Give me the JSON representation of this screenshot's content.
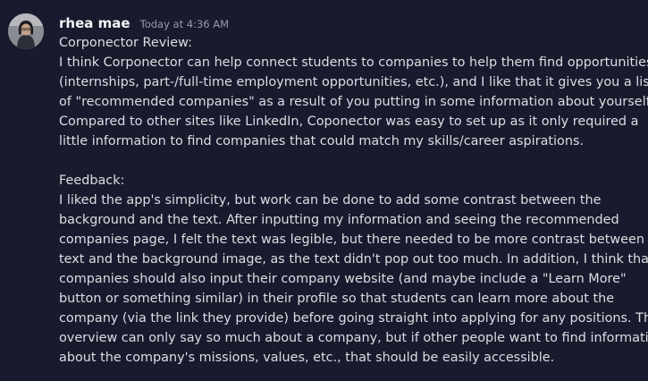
{
  "message": {
    "author": "rhea mae",
    "timestamp": "Today at 4:36 AM",
    "review_title": "Corponector Review:",
    "review_lines": [
      "I think Corponector can help connect students to companies to help them find opportunities",
      "(internships, part-/full-time employment opportunities, etc.), and I like that it gives you a list",
      "of \"recommended companies\" as a result of you putting in some information about yourself.",
      "Compared to other sites like LinkedIn, Coponector was easy to set up as it only required a",
      "little information to find companies that could match my skills/career aspirations."
    ],
    "feedback_title": "Feedback:",
    "feedback_lines": [
      "I liked the app's simplicity, but work can be done to add some contrast between the",
      "background and the text. After inputting my information and seeing the recommended",
      "companies page, I felt the text was legible, but there needed to be more contrast between the",
      "text and the background image, as the text didn't pop out too much. In addition, I think that",
      "companies should also input their company website (and maybe include a \"Learn More\"",
      "button or something similar) in their profile so that students can learn more about the",
      "company (via the link they provide) before going straight into applying for any positions. The",
      "overview can only say so much about a company, but if other people want to find information",
      "about the company's missions, values, etc., that should be easily accessible."
    ]
  },
  "colors": {
    "background": "#1a1a2e",
    "text": "#dbdee1",
    "username": "#f2f3f5",
    "timestamp": "#9a9ca3"
  }
}
